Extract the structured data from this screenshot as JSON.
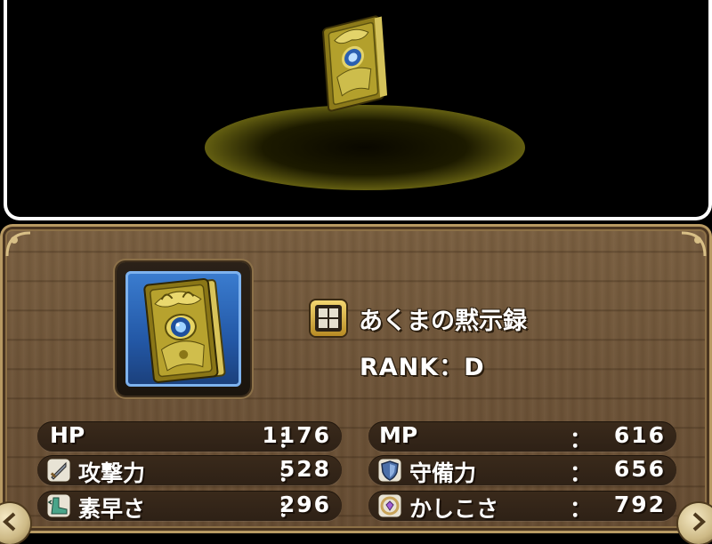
{
  "item": {
    "name": "あくまの黙示録",
    "rank": "RANK：D"
  },
  "stats": {
    "hp": {
      "label": "HP",
      "colon": "：",
      "value": "1176"
    },
    "mp": {
      "label": "MP",
      "colon": "：",
      "value": "616"
    },
    "atk": {
      "label": "攻撃力",
      "colon": "：",
      "value": "528",
      "icon": "sword-icon"
    },
    "def": {
      "label": "守備力",
      "colon": "：",
      "value": "656",
      "icon": "shield-icon"
    },
    "spd": {
      "label": "素早さ",
      "colon": "：",
      "value": "296",
      "icon": "boot-icon"
    },
    "wis": {
      "label": "かしこさ",
      "colon": "：",
      "value": "792",
      "icon": "gem-ring-icon"
    }
  },
  "colors": {
    "wood": "#6e5438",
    "stat_bar": "#2e2116",
    "gold": "#e0c050",
    "thumb_blue": "#2358a6"
  }
}
